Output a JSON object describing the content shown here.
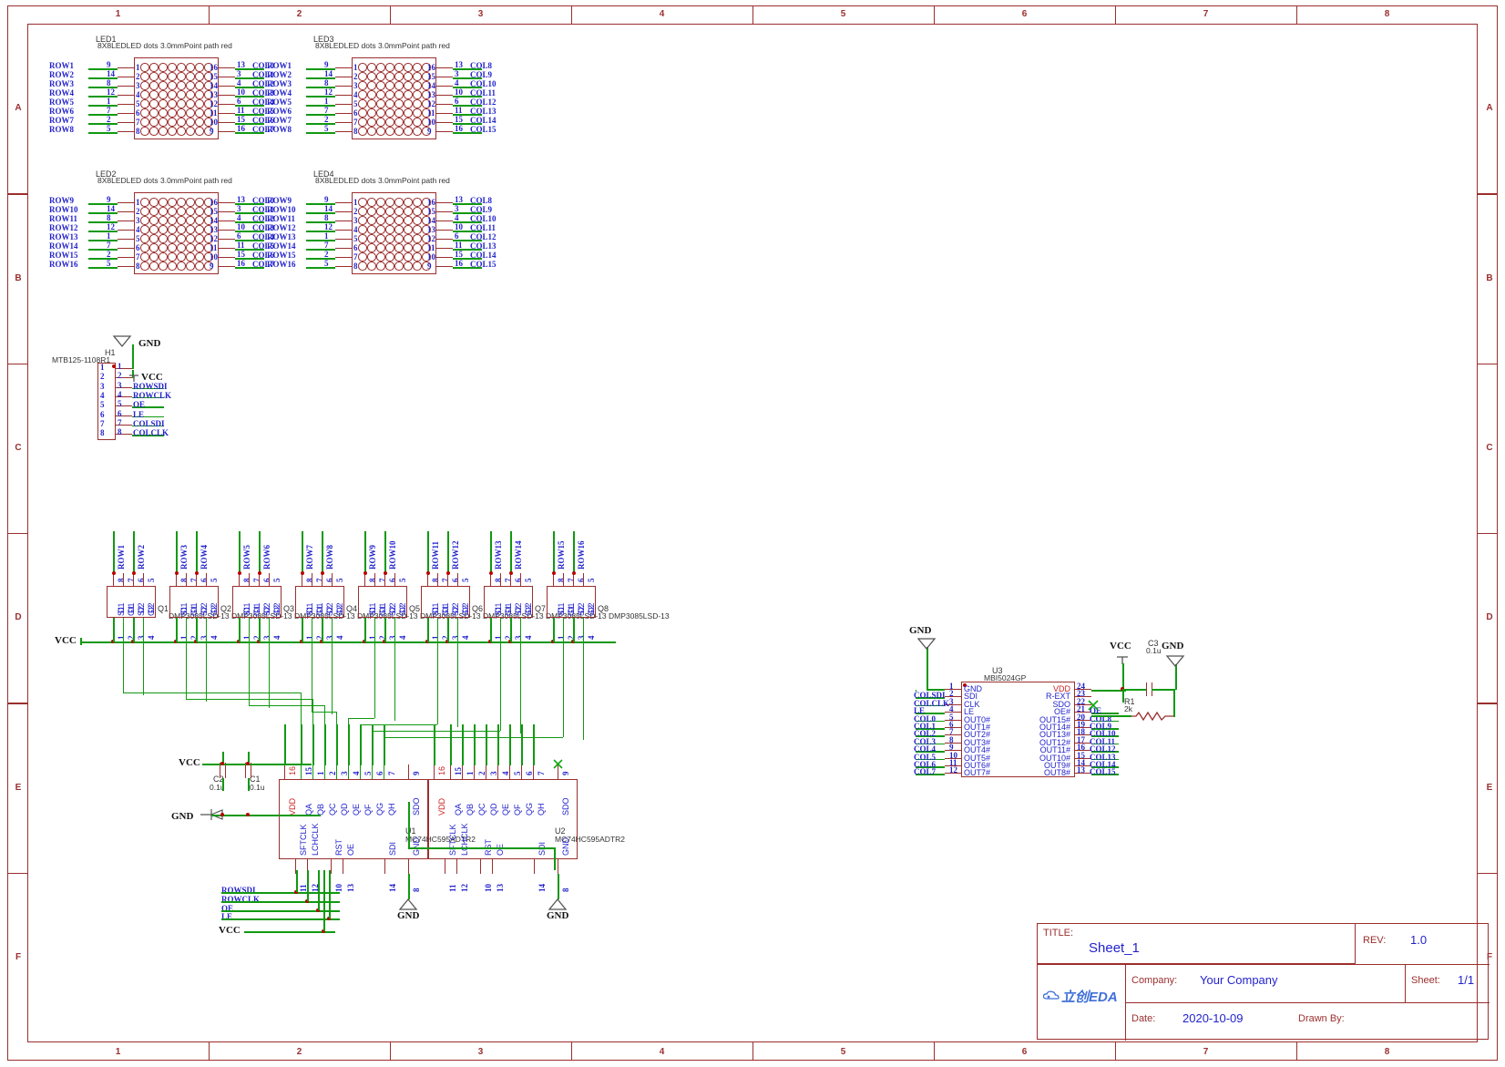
{
  "sheet": {
    "zones_top": [
      "1",
      "2",
      "3",
      "4",
      "5",
      "6",
      "7",
      "8"
    ],
    "zones_side": [
      "A",
      "B",
      "C",
      "D",
      "E",
      "F"
    ]
  },
  "title_block": {
    "title_label": "TITLE:",
    "title_value": "Sheet_1",
    "rev_label": "REV:",
    "rev_value": "1.0",
    "company_label": "Company:",
    "company_value": "Your Company",
    "sheet_label": "Sheet:",
    "sheet_value": "1/1",
    "date_label": "Date:",
    "date_value": "2020-10-09",
    "drawn_label": "Drawn By:",
    "drawn_value": "",
    "logo_text": "立创EDA"
  },
  "leds": [
    {
      "desig": "LED1",
      "part": "8X8LEDLED dots 3.0mmPoint path red",
      "left_nets": [
        "ROW1",
        "ROW2",
        "ROW3",
        "ROW4",
        "ROW5",
        "ROW6",
        "ROW7",
        "ROW8"
      ],
      "left_pinnums": [
        "9",
        "14",
        "8",
        "12",
        "1",
        "7",
        "2",
        "5"
      ],
      "left_inner": [
        "1",
        "2",
        "3",
        "4",
        "5",
        "6",
        "7",
        "8"
      ],
      "right_inner": [
        "16",
        "15",
        "14",
        "13",
        "12",
        "11",
        "10",
        "9"
      ],
      "right_pinnums": [
        "13",
        "3",
        "4",
        "10",
        "6",
        "11",
        "15",
        "16"
      ],
      "right_nets": [
        "COL0",
        "COL1",
        "COL2",
        "COL3",
        "COL4",
        "COL5",
        "COL6",
        "COL7"
      ]
    },
    {
      "desig": "LED3",
      "part": "8X8LEDLED dots 3.0mmPoint path red",
      "left_nets": [
        "ROW1",
        "ROW2",
        "ROW3",
        "ROW4",
        "ROW5",
        "ROW6",
        "ROW7",
        "ROW8"
      ],
      "left_pinnums": [
        "9",
        "14",
        "8",
        "12",
        "1",
        "7",
        "2",
        "5"
      ],
      "left_inner": [
        "1",
        "2",
        "3",
        "4",
        "5",
        "6",
        "7",
        "8"
      ],
      "right_inner": [
        "16",
        "15",
        "14",
        "13",
        "12",
        "11",
        "10",
        "9"
      ],
      "right_pinnums": [
        "13",
        "3",
        "4",
        "10",
        "6",
        "11",
        "15",
        "16"
      ],
      "right_nets": [
        "COL8",
        "COL9",
        "COL10",
        "COL11",
        "COL12",
        "COL13",
        "COL14",
        "COL15"
      ]
    },
    {
      "desig": "LED2",
      "part": "8X8LEDLED dots 3.0mmPoint path red",
      "left_nets": [
        "ROW9",
        "ROW10",
        "ROW11",
        "ROW12",
        "ROW13",
        "ROW14",
        "ROW15",
        "ROW16"
      ],
      "left_pinnums": [
        "9",
        "14",
        "8",
        "12",
        "1",
        "7",
        "2",
        "5"
      ],
      "left_inner": [
        "1",
        "2",
        "3",
        "4",
        "5",
        "6",
        "7",
        "8"
      ],
      "right_inner": [
        "16",
        "15",
        "14",
        "13",
        "12",
        "11",
        "10",
        "9"
      ],
      "right_pinnums": [
        "13",
        "3",
        "4",
        "10",
        "6",
        "11",
        "15",
        "16"
      ],
      "right_nets": [
        "COL0",
        "COL1",
        "COL2",
        "COL3",
        "COL4",
        "COL5",
        "COL6",
        "COL7"
      ]
    },
    {
      "desig": "LED4",
      "part": "8X8LEDLED dots 3.0mmPoint path red",
      "left_nets": [
        "ROW9",
        "ROW10",
        "ROW11",
        "ROW12",
        "ROW13",
        "ROW14",
        "ROW15",
        "ROW16"
      ],
      "left_pinnums": [
        "9",
        "14",
        "8",
        "12",
        "1",
        "7",
        "2",
        "5"
      ],
      "left_inner": [
        "1",
        "2",
        "3",
        "4",
        "5",
        "6",
        "7",
        "8"
      ],
      "right_inner": [
        "16",
        "15",
        "14",
        "13",
        "12",
        "11",
        "10",
        "9"
      ],
      "right_pinnums": [
        "13",
        "3",
        "4",
        "10",
        "6",
        "11",
        "15",
        "16"
      ],
      "right_nets": [
        "COL8",
        "COL9",
        "COL10",
        "COL11",
        "COL12",
        "COL13",
        "COL14",
        "COL15"
      ]
    }
  ],
  "header_h1": {
    "desig": "H1",
    "part": "MTB125-1108R1",
    "pins": [
      "1",
      "2",
      "3",
      "4",
      "5",
      "6",
      "7",
      "8"
    ],
    "nets": [
      "",
      "",
      "ROWSDI",
      "ROWCLK",
      "OE",
      "LE",
      "COLSDI",
      "COLCLK"
    ],
    "gnd_label": "GND",
    "vcc_label": "VCC"
  },
  "transistors": [
    {
      "desig": "Q1",
      "part": "DMP3085LSD-13",
      "top_nets": [
        "ROW1",
        "ROW2"
      ],
      "top_pins": [
        "8",
        "7",
        "6",
        "5"
      ],
      "pinlabels": [
        "D1",
        "D1",
        "D2",
        "D2"
      ],
      "bot_labels": [
        "S1",
        "G1",
        "S2",
        "G2"
      ],
      "bot_pins": [
        "1",
        "2",
        "3",
        "4"
      ]
    },
    {
      "desig": "Q2",
      "part": "DMP3085LSD-13",
      "top_nets": [
        "ROW3",
        "ROW4"
      ],
      "top_pins": [
        "8",
        "7",
        "6",
        "5"
      ],
      "pinlabels": [
        "D1",
        "D1",
        "D2",
        "D2"
      ],
      "bot_labels": [
        "S1",
        "G1",
        "S2",
        "G2"
      ],
      "bot_pins": [
        "1",
        "2",
        "3",
        "4"
      ]
    },
    {
      "desig": "Q3",
      "part": "DMP3085LSD-13",
      "top_nets": [
        "ROW5",
        "ROW6"
      ],
      "top_pins": [
        "8",
        "7",
        "6",
        "5"
      ],
      "pinlabels": [
        "D1",
        "D1",
        "D2",
        "D2"
      ],
      "bot_labels": [
        "S1",
        "G1",
        "S2",
        "G2"
      ],
      "bot_pins": [
        "1",
        "2",
        "3",
        "4"
      ]
    },
    {
      "desig": "Q4",
      "part": "DMP3085LSD-13",
      "top_nets": [
        "ROW7",
        "ROW8"
      ],
      "top_pins": [
        "8",
        "7",
        "6",
        "5"
      ],
      "pinlabels": [
        "D1",
        "D1",
        "D2",
        "D2"
      ],
      "bot_labels": [
        "S1",
        "G1",
        "S2",
        "G2"
      ],
      "bot_pins": [
        "1",
        "2",
        "3",
        "4"
      ]
    },
    {
      "desig": "Q5",
      "part": "DMP3085LSD-13",
      "top_nets": [
        "ROW9",
        "ROW10"
      ],
      "top_pins": [
        "8",
        "7",
        "6",
        "5"
      ],
      "pinlabels": [
        "D1",
        "D1",
        "D2",
        "D2"
      ],
      "bot_labels": [
        "S1",
        "G1",
        "S2",
        "G2"
      ],
      "bot_pins": [
        "1",
        "2",
        "3",
        "4"
      ]
    },
    {
      "desig": "Q6",
      "part": "DMP3085LSD-13",
      "top_nets": [
        "ROW11",
        "ROW12"
      ],
      "top_pins": [
        "8",
        "7",
        "6",
        "5"
      ],
      "pinlabels": [
        "D1",
        "D1",
        "D2",
        "D2"
      ],
      "bot_labels": [
        "S1",
        "G1",
        "S2",
        "G2"
      ],
      "bot_pins": [
        "1",
        "2",
        "3",
        "4"
      ]
    },
    {
      "desig": "Q7",
      "part": "DMP3085LSD-13",
      "top_nets": [
        "ROW13",
        "ROW14"
      ],
      "top_pins": [
        "8",
        "7",
        "6",
        "5"
      ],
      "pinlabels": [
        "D1",
        "D1",
        "D2",
        "D2"
      ],
      "bot_labels": [
        "S1",
        "G1",
        "S2",
        "G2"
      ],
      "bot_pins": [
        "1",
        "2",
        "3",
        "4"
      ]
    },
    {
      "desig": "Q8",
      "part": "DMP3085LSD-13",
      "top_nets": [
        "ROW15",
        "ROW16"
      ],
      "top_pins": [
        "8",
        "7",
        "6",
        "5"
      ],
      "pinlabels": [
        "D1",
        "D1",
        "D2",
        "D2"
      ],
      "bot_labels": [
        "S1",
        "G1",
        "S2",
        "G2"
      ],
      "bot_pins": [
        "1",
        "2",
        "3",
        "4"
      ]
    }
  ],
  "shift_registers": [
    {
      "desig": "U1",
      "part": "MC74HC595ADTR2",
      "top_pins": [
        "16",
        "15",
        "1",
        "2",
        "3",
        "4",
        "5",
        "6",
        "7",
        "9"
      ],
      "top_labels": [
        "VDD",
        "QA",
        "QB",
        "QC",
        "QD",
        "QE",
        "QF",
        "QG",
        "QH",
        "SDO"
      ],
      "bot_pins": [
        "11",
        "12",
        "10",
        "13",
        "14",
        "8"
      ],
      "bot_labels": [
        "SFTCLK",
        "LCHCLK",
        "RST",
        "OE",
        "SDI",
        "GND"
      ]
    },
    {
      "desig": "U2",
      "part": "MC74HC595ADTR2",
      "top_pins": [
        "16",
        "15",
        "1",
        "2",
        "3",
        "4",
        "5",
        "6",
        "7",
        "9"
      ],
      "top_labels": [
        "VDD",
        "QA",
        "QB",
        "QC",
        "QD",
        "QE",
        "QF",
        "QG",
        "QH",
        "SDO"
      ],
      "bot_pins": [
        "11",
        "12",
        "10",
        "13",
        "14",
        "8"
      ],
      "bot_labels": [
        "SFTCLK",
        "LCHCLK",
        "RST",
        "OE",
        "SDI",
        "GND"
      ]
    }
  ],
  "driver_u3": {
    "desig": "U3",
    "part": "MBI5024GP",
    "left_pins": [
      "1",
      "2",
      "3",
      "4",
      "5",
      "6",
      "7",
      "8",
      "9",
      "10",
      "11",
      "12"
    ],
    "left_nets": [
      "",
      "COLSDI",
      "COLCLK",
      "LE",
      "COL0",
      "COL1",
      "COL2",
      "COL3",
      "COL4",
      "COL5",
      "COL6",
      "COL7"
    ],
    "left_labels": [
      "GND",
      "SDI",
      "CLK",
      "LE",
      "OUT0#",
      "OUT1#",
      "OUT2#",
      "OUT3#",
      "OUT4#",
      "OUT5#",
      "OUT6#",
      "OUT7#"
    ],
    "right_labels": [
      "VDD",
      "R-EXT",
      "SDO",
      "OE#",
      "OUT15#",
      "OUT14#",
      "OUT13#",
      "OUT12#",
      "OUT11#",
      "OUT10#",
      "OUT9#",
      "OUT8#"
    ],
    "right_pins": [
      "24",
      "23",
      "22",
      "21",
      "20",
      "19",
      "18",
      "17",
      "16",
      "15",
      "14",
      "13"
    ],
    "right_nets": [
      "",
      "",
      "",
      "OE",
      "COL8",
      "COL9",
      "COL10",
      "COL11",
      "COL12",
      "COL13",
      "COL14",
      "COL15"
    ]
  },
  "passives": [
    {
      "desig": "C1",
      "value": "0.1u"
    },
    {
      "desig": "C2",
      "value": "0.1u"
    },
    {
      "desig": "C3",
      "value": "0.1u"
    },
    {
      "desig": "R1",
      "value": "2k"
    }
  ],
  "power_symbols": {
    "vcc": "VCC",
    "gnd": "GND"
  },
  "bus_labels": [
    "ROWSDI",
    "ROWCLK",
    "OE",
    "LE",
    "VCC"
  ],
  "colors": {
    "wire_green": "#119911",
    "wire_red": "#9b2e2e",
    "net_blue": "#2222cc",
    "frame": "#9b2e2e",
    "junction": "#bb0000"
  }
}
